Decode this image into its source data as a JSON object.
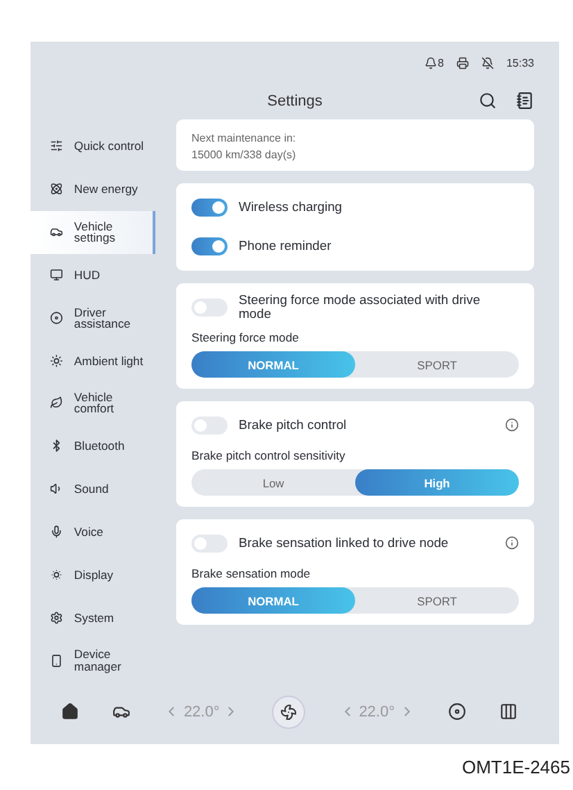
{
  "status_bar": {
    "notification_count": "8",
    "time": "15:33"
  },
  "header": {
    "title": "Settings"
  },
  "sidebar": {
    "items": [
      {
        "label": "Quick control",
        "selected": false
      },
      {
        "label": "New energy",
        "selected": false
      },
      {
        "label": "Vehicle settings",
        "selected": true
      },
      {
        "label": "HUD",
        "selected": false
      },
      {
        "label": "Driver assistance",
        "selected": false
      },
      {
        "label": "Ambient light",
        "selected": false
      },
      {
        "label": "Vehicle comfort",
        "selected": false
      },
      {
        "label": "Bluetooth",
        "selected": false
      },
      {
        "label": "Sound",
        "selected": false
      },
      {
        "label": "Voice",
        "selected": false
      },
      {
        "label": "Display",
        "selected": false
      },
      {
        "label": "System",
        "selected": false
      },
      {
        "label": "Device manager",
        "selected": false
      }
    ]
  },
  "maintenance": {
    "lines": [
      "Next maintenance in:",
      "15000 km/338 day(s)"
    ]
  },
  "cards": [
    {
      "kind": "toggles",
      "toggles": [
        {
          "label": "Wireless charging",
          "on": true
        },
        {
          "label": "Phone reminder",
          "on": true
        }
      ]
    },
    {
      "kind": "mode",
      "toggle": {
        "label": "Steering force mode associated with drive mode",
        "on": false
      },
      "info": false,
      "mode_label": "Steering force mode",
      "options": [
        {
          "label": "NORMAL",
          "selected": true
        },
        {
          "label": "SPORT",
          "selected": false
        }
      ]
    },
    {
      "kind": "mode",
      "toggle": {
        "label": "Brake pitch control",
        "on": false
      },
      "info": true,
      "mode_label": "Brake pitch control sensitivity",
      "options": [
        {
          "label": "Low",
          "selected": false
        },
        {
          "label": "High",
          "selected": true
        }
      ]
    },
    {
      "kind": "mode",
      "toggle": {
        "label": "Brake sensation linked to drive node",
        "on": false
      },
      "info": true,
      "mode_label": "Brake sensation mode",
      "options": [
        {
          "label": "NORMAL",
          "selected": true
        },
        {
          "label": "SPORT",
          "selected": false
        }
      ]
    }
  ],
  "climate_bar": {
    "temperatures": [
      "22.0°",
      "22.0°"
    ]
  },
  "caption": "OMT1E-2465"
}
